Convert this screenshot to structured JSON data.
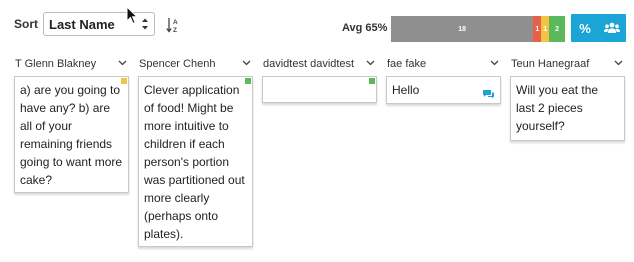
{
  "toolbar": {
    "sort_label": "Sort",
    "sort_value": "Last Name",
    "avg_label": "Avg 65%"
  },
  "distribution": {
    "segments": [
      {
        "label": "18",
        "value": 18,
        "color": "#8f8f8f"
      },
      {
        "label": "1",
        "value": 1,
        "color": "#e8604c"
      },
      {
        "label": "1",
        "value": 1,
        "color": "#f2c443"
      },
      {
        "label": "2",
        "value": 2,
        "color": "#5bb85d"
      }
    ]
  },
  "buttons": {
    "percent_label": "%"
  },
  "columns": [
    {
      "name": "T Glenn Blakney",
      "response": "a) are you going to have any? b) are all of your remaining friends going to want more cake?",
      "dot_color": "#f2c443",
      "has_comment": false
    },
    {
      "name": "Spencer Chenh",
      "response": "Clever application of food! Might be more intuitive to children if each person's portion was partitioned out more clearly (perhaps onto plates).",
      "dot_color": "#5bb85d",
      "has_comment": false
    },
    {
      "name": "davidtest davidtest",
      "response": "",
      "dot_color": "#5bb85d",
      "has_comment": false
    },
    {
      "name": "fae fake",
      "response": "Hello",
      "dot_color": "",
      "has_comment": true
    },
    {
      "name": "Teun Hanegraaf",
      "response": "Will you eat the last 2 pieces yourself?",
      "dot_color": "",
      "has_comment": false
    }
  ],
  "icons": {
    "sort_caret": "sort-caret-icon",
    "sort_direction": "sort-az-icon",
    "group": "users-icon",
    "comment": "chat-bubble-icon",
    "column_menu": "chevron-down-icon"
  }
}
